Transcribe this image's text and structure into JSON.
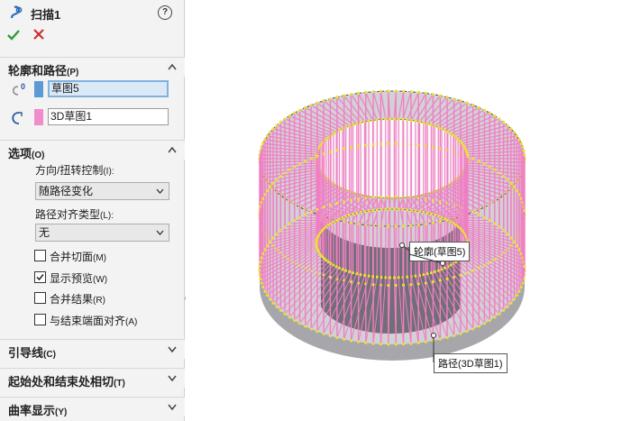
{
  "panel": {
    "title": "扫描1",
    "icons": {
      "tool": "sweep-icon",
      "help": "help-icon",
      "ok": "checkmark-icon",
      "cancel": "close-icon",
      "profile": "profile-selection-icon",
      "path": "path-selection-icon"
    },
    "help_glyph": "?",
    "profile_section": {
      "label": "轮廓和路径",
      "shortcut": "(P)",
      "profile_value": "草图5",
      "path_value": "3D草图1",
      "profile_color": "#5b9bd5",
      "path_color": "#f08cc8"
    },
    "options_section": {
      "label": "选项",
      "shortcut": "(O)",
      "orientation_label": "方向/扭转控制",
      "orientation_shortcut": "(I):",
      "orientation_value": "随路径变化",
      "alignment_label": "路径对齐类型",
      "alignment_shortcut": "(L):",
      "alignment_value": "无",
      "checkboxes": [
        {
          "label": "合并切面",
          "shortcut": "(M)",
          "checked": false
        },
        {
          "label": "显示预览",
          "shortcut": "(W)",
          "checked": true
        },
        {
          "label": "合并结果",
          "shortcut": "(R)",
          "checked": false
        },
        {
          "label": "与结束端面对齐",
          "shortcut": "(A)",
          "checked": false
        }
      ]
    },
    "collapsed_sections": [
      {
        "label": "引导线",
        "shortcut": "(C)"
      },
      {
        "label": "起始处和结束处相切",
        "shortcut": "(T)"
      },
      {
        "label": "曲率显示",
        "shortcut": "(Y)"
      }
    ]
  },
  "viewport": {
    "callout_profile": "轮廓(草图5)",
    "callout_path": "路径(3D草图1)",
    "colors": {
      "wire_pink": "#f07fc4",
      "wire_yellow": "#e6e03a",
      "solid_gray": "#7d7a88",
      "dark_gray": "#3f3f47"
    }
  }
}
